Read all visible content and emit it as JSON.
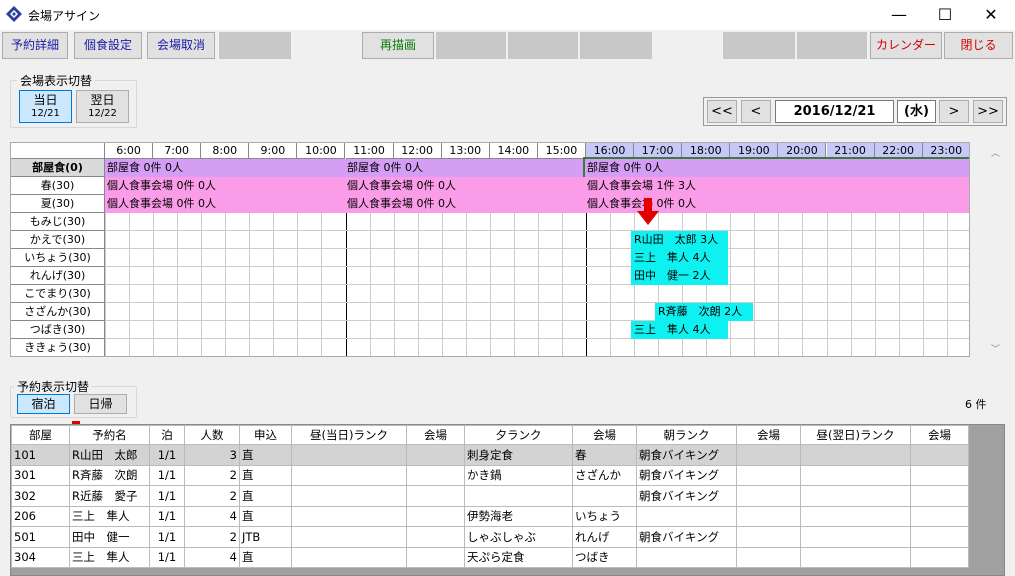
{
  "window": {
    "title": "会場アサイン",
    "minimize": "—",
    "maximize": "☐",
    "close": "✕"
  },
  "toolbar": {
    "reservation_detail": "予約詳細",
    "private_dining": "個食設定",
    "venue_cancel": "会場取消",
    "redraw": "再描画",
    "calendar": "カレンダー",
    "close": "閉じる"
  },
  "venue_toggle": {
    "label": "会場表示切替",
    "today": "当日",
    "today_date": "12/21",
    "next": "翌日",
    "next_date": "12/22"
  },
  "date_nav": {
    "first": "<<",
    "prev": "<",
    "date": "2016/12/21",
    "weekday": "(水)",
    "next": ">",
    "last": ">>"
  },
  "timeline": {
    "hours": [
      "6:00",
      "7:00",
      "8:00",
      "9:00",
      "10:00",
      "11:00",
      "12:00",
      "13:00",
      "14:00",
      "15:00",
      "16:00",
      "17:00",
      "18:00",
      "19:00",
      "20:00",
      "21:00",
      "22:00",
      "23:00"
    ],
    "rooms": [
      "部屋食(0)",
      "春(30)",
      "夏(30)",
      "もみじ(30)",
      "かえで(30)",
      "いちょう(30)",
      "れんげ(30)",
      "こでまり(30)",
      "さざんか(30)",
      "つばき(30)",
      "ききょう(30)"
    ],
    "bands": {
      "r0_a": "部屋食 0件 0人",
      "r0_b": "部屋食 0件 0人",
      "r0_c": "部屋食 0件 0人",
      "r1_a": "個人食事会場 0件 0人",
      "r1_b": "個人食事会場 0件 0人",
      "r1_c": "個人食事会場 1件 3人",
      "r2_a": "個人食事会場 0件 0人",
      "r2_b": "個人食事会場 0件 0人",
      "r2_c": "個人食事会場 0件 0人"
    },
    "bookings": {
      "kaede": "R山田　太郎 3人",
      "icho": "三上　隼人 4人",
      "renge": "田中　健一 2人",
      "sazanka": "R斉藤　次朗 2人",
      "tsubaki": "三上　隼人 4人"
    }
  },
  "reservation_toggle": {
    "label": "予約表示切替",
    "stay": "宿泊",
    "day": "日帰"
  },
  "count": "6 件",
  "list": {
    "headers": [
      "部屋",
      "予約名",
      "泊",
      "人数",
      "申込",
      "昼(当日)ランク",
      "会場",
      "夕ランク",
      "会場",
      "朝ランク",
      "会場",
      "昼(翌日)ランク",
      "会場"
    ],
    "rows": [
      [
        "101",
        "R山田　太郎",
        "1/1",
        "3",
        "直",
        "",
        "",
        "刺身定食",
        "春",
        "朝食バイキング",
        "",
        "",
        ""
      ],
      [
        "301",
        "R斉藤　次朗",
        "1/1",
        "2",
        "直",
        "",
        "",
        "かき鍋",
        "さざんか",
        "朝食バイキング",
        "",
        "",
        ""
      ],
      [
        "302",
        "R近藤　愛子",
        "1/1",
        "2",
        "直",
        "",
        "",
        "",
        "",
        "朝食バイキング",
        "",
        "",
        ""
      ],
      [
        "206",
        "三上　隼人",
        "1/1",
        "4",
        "直",
        "",
        "",
        "伊勢海老",
        "いちょう",
        "",
        "",
        "",
        ""
      ],
      [
        "501",
        "田中　健一",
        "1/1",
        "2",
        "JTB",
        "",
        "",
        "しゃぶしゃぶ",
        "れんげ",
        "朝食バイキング",
        "",
        "",
        ""
      ],
      [
        "304",
        "三上　隼人",
        "1/1",
        "4",
        "直",
        "",
        "",
        "天ぷら定食",
        "つばき",
        "",
        "",
        "",
        ""
      ]
    ]
  }
}
